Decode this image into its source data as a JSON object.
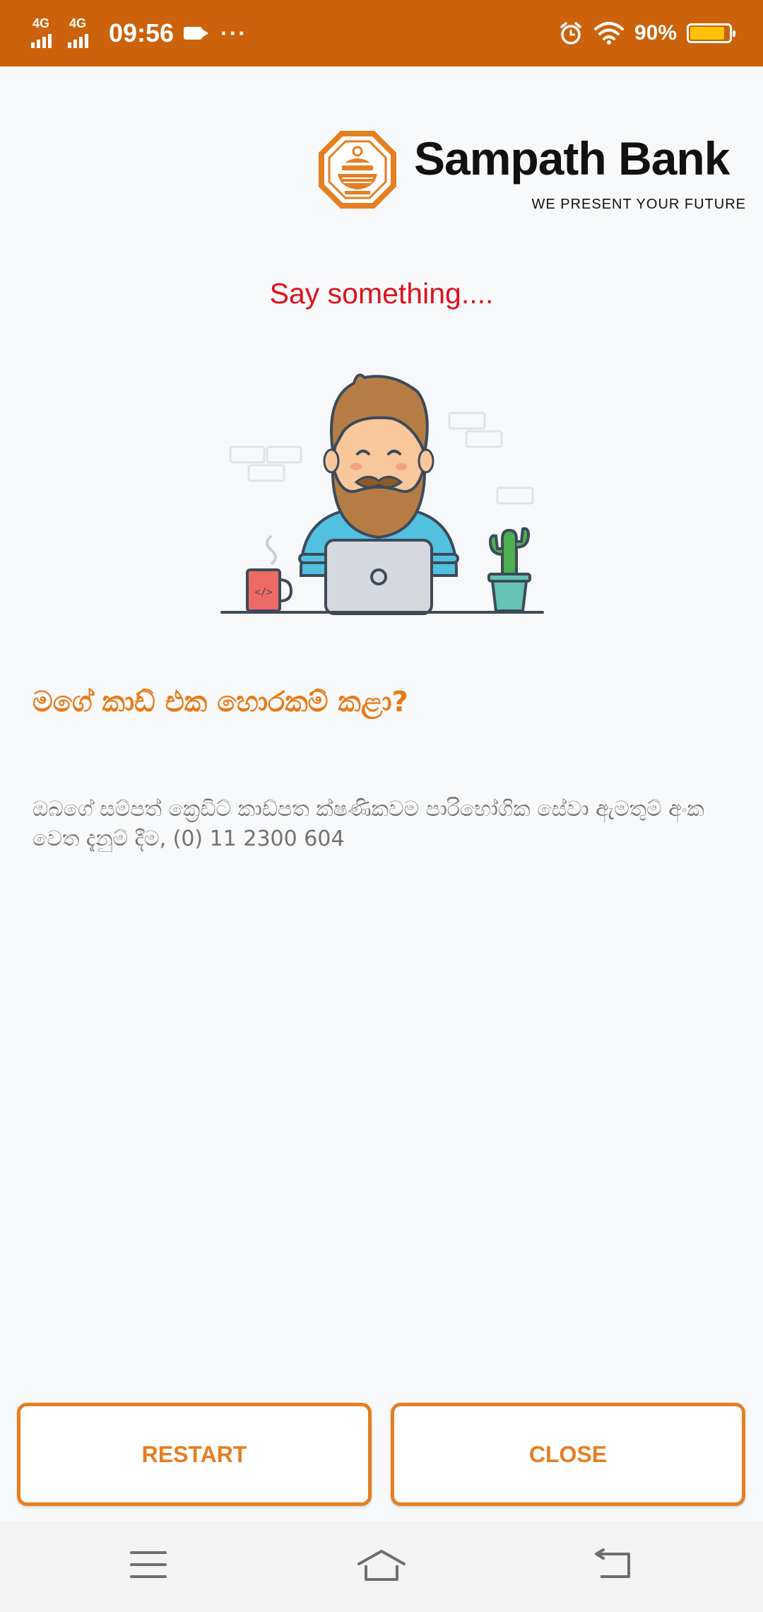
{
  "status_bar": {
    "network_1": "4G",
    "network_2": "4G",
    "time": "09:56",
    "more": "···",
    "battery_percent": "90%",
    "battery_level": 0.9
  },
  "brand": {
    "name": "Sampath Bank",
    "tagline": "WE PRESENT YOUR FUTURE",
    "color": "#e67e22"
  },
  "prompt": "Say something....",
  "card": {
    "headline": "මගේ කාඩ් එක හොරකම් කළා?",
    "message": "ඔබගේ සම්පත් ක්‍රෙඩිට් කාඩ්පත ක්ෂණිකවම පාරිභෝගික සේවා ඇමතුම් අංක වෙත දැනුම් දීම, (0) 11 2300 604"
  },
  "buttons": {
    "restart": "RESTART",
    "close": "CLOSE"
  },
  "illustration_icons": [
    "developer-illustration",
    "coffee-mug-icon",
    "laptop-icon",
    "cactus-icon"
  ],
  "nav_icons": [
    "menu-icon",
    "home-icon",
    "back-icon"
  ],
  "colors": {
    "status_bar": "#cc620b",
    "prompt": "#e0101c",
    "accent": "#e87a16",
    "background": "#f8f9fa"
  }
}
